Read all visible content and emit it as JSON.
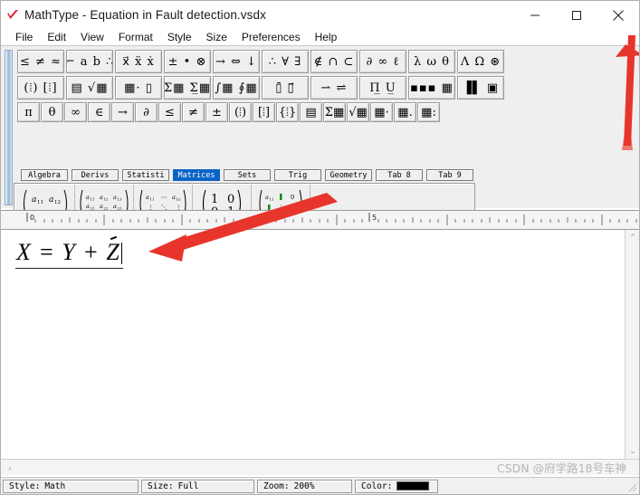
{
  "window": {
    "title": "MathType - Equation in Fault detection.vsdx",
    "app_icon": "mathtype-checkmark-icon",
    "controls": {
      "minimize": "minimize-icon",
      "maximize": "maximize-icon",
      "close": "close-icon"
    }
  },
  "menu": {
    "items": [
      "File",
      "Edit",
      "View",
      "Format",
      "Style",
      "Size",
      "Preferences",
      "Help"
    ]
  },
  "toolbar": {
    "row1": [
      {
        "name": "relations-palette",
        "glyphs": "≤ ≠ ≈"
      },
      {
        "name": "spaces-and-dots-palette",
        "glyphs": "⌐ a b ∴"
      },
      {
        "name": "embellishments-palette",
        "glyphs": "x⃗ ẍ ẋ"
      },
      {
        "name": "operators-palette",
        "glyphs": "± • ⊗"
      },
      {
        "name": "arrows-palette",
        "glyphs": "→ ⇔ ↓"
      },
      {
        "name": "logic-palette",
        "glyphs": "∴ ∀ ∃"
      },
      {
        "name": "set-theory-palette",
        "glyphs": "∉ ∩ ⊂"
      },
      {
        "name": "miscellaneous-palette",
        "glyphs": "∂ ∞ ℓ"
      },
      {
        "name": "greek-lowercase-palette",
        "glyphs": "λ ω θ"
      },
      {
        "name": "greek-uppercase-palette",
        "glyphs": "Λ Ω ⊛"
      }
    ],
    "row2": [
      {
        "name": "fence-templates-palette",
        "glyphs": "(⦙) [⦙]"
      },
      {
        "name": "fraction-radical-templates-palette",
        "glyphs": "▤ √▦"
      },
      {
        "name": "subscript-superscript-templates-palette",
        "glyphs": "▦· ▯"
      },
      {
        "name": "summation-templates-palette",
        "glyphs": "Σ▦ Σ̲▦"
      },
      {
        "name": "integral-templates-palette",
        "glyphs": "∫▦ ∮▦"
      },
      {
        "name": "underbar-overbar-templates-palette",
        "glyphs": "▯̄ ▯⃗"
      },
      {
        "name": "labeled-arrow-templates-palette",
        "glyphs": "⇀ ⇌"
      },
      {
        "name": "product-set-theory-templates-palette",
        "glyphs": "Π̲ U̲"
      },
      {
        "name": "matrix-templates-palette",
        "glyphs": "▪▪▪ ▦"
      },
      {
        "name": "large-matrix-templates-palette",
        "glyphs": "▐▌ ▣"
      }
    ],
    "row3": [
      {
        "name": "symbol-pi",
        "glyph": "π"
      },
      {
        "name": "symbol-theta",
        "glyph": "θ"
      },
      {
        "name": "symbol-infinity",
        "glyph": "∞"
      },
      {
        "name": "symbol-element-of",
        "glyph": "∈"
      },
      {
        "name": "symbol-right-arrow",
        "glyph": "→"
      },
      {
        "name": "symbol-partial-derivative",
        "glyph": "∂"
      },
      {
        "name": "symbol-less-than-or-equal",
        "glyph": "≤"
      },
      {
        "name": "symbol-not-equal",
        "glyph": "≠"
      },
      {
        "name": "symbol-plus-minus",
        "glyph": "±"
      },
      {
        "name": "template-round-fence",
        "glyph": "(⦙)"
      },
      {
        "name": "template-square-fence",
        "glyph": "[⦙]"
      },
      {
        "name": "template-curly-fence",
        "glyph": "{⦙}"
      },
      {
        "name": "template-fraction",
        "glyph": "▤"
      },
      {
        "name": "template-summation",
        "glyph": "Σ̇▦"
      },
      {
        "name": "template-radical",
        "glyph": "√▦"
      },
      {
        "name": "template-superscript",
        "glyph": "▦·"
      },
      {
        "name": "template-subscript",
        "glyph": "▦."
      },
      {
        "name": "template-sub-superscript",
        "glyph": "▦:"
      }
    ]
  },
  "tabs": {
    "items": [
      "Algebra",
      "Derivs",
      "Statisti",
      "Matrices",
      "Sets",
      "Trig",
      "Geometry",
      "Tab 8",
      "Tab 9"
    ],
    "selected": "Matrices",
    "selected_index": 3
  },
  "gallery": {
    "items": [
      {
        "name": "matrix-2x2-template",
        "label": "2x2 matrix"
      },
      {
        "name": "matrix-3x3-template",
        "label": "3x3 matrix"
      },
      {
        "name": "matrix-mxn-template",
        "label": "m x n matrix with ellipses"
      },
      {
        "name": "identity-matrix-template",
        "label": "2x2 identity matrix"
      },
      {
        "name": "matrix-with-dividers-template",
        "label": "matrix with dividers"
      }
    ],
    "dots": [
      {
        "name": "lower-dots-template",
        "glyph": "…"
      },
      {
        "name": "center-dots-template",
        "glyph": "⋯"
      },
      {
        "name": "vertical-dots-template",
        "glyph": "⋮"
      },
      {
        "name": "up-diagonal-dots-template",
        "glyph": "⋰"
      },
      {
        "name": "down-diagonal-dots-template",
        "glyph": "⋱"
      }
    ],
    "alignment": [
      {
        "name": "align-at-baseline-button",
        "selected": true
      },
      {
        "name": "align-at-top-button",
        "selected": false
      },
      {
        "name": "align-at-center-button",
        "selected": false
      },
      {
        "name": "align-at-equals-button",
        "selected": false
      },
      {
        "name": "align-at-decimal-button",
        "selected": false
      }
    ]
  },
  "ruler": {
    "labels": [
      "0",
      "5"
    ],
    "unit": "inches"
  },
  "equation": {
    "text": "X = Y + Z",
    "tokens": [
      "X",
      "=",
      "Y",
      "+",
      "Z"
    ],
    "slot_underlined": true,
    "caret_after": "Z"
  },
  "status": {
    "style_label": "Style:",
    "style_value": "Math",
    "size_label": "Size:",
    "size_value": "Full",
    "zoom_label": "Zoom:",
    "zoom_value": "200%",
    "color_label": "Color:",
    "color_value": "#000000"
  },
  "watermark": {
    "text": "CSDN @府学路18号车神"
  },
  "annotations": {
    "arrow_color": "#e8352b",
    "arrows": [
      {
        "name": "annotation-arrow-to-close-button",
        "direction": "up",
        "target": "close-button"
      },
      {
        "name": "annotation-arrow-to-equation",
        "direction": "down-left",
        "target": "equation-area"
      }
    ]
  },
  "scrollbars": {
    "vertical": {
      "up_glyph": "⌃",
      "down_glyph": "⌄"
    },
    "horizontal": {
      "left_glyph": "‹"
    }
  }
}
